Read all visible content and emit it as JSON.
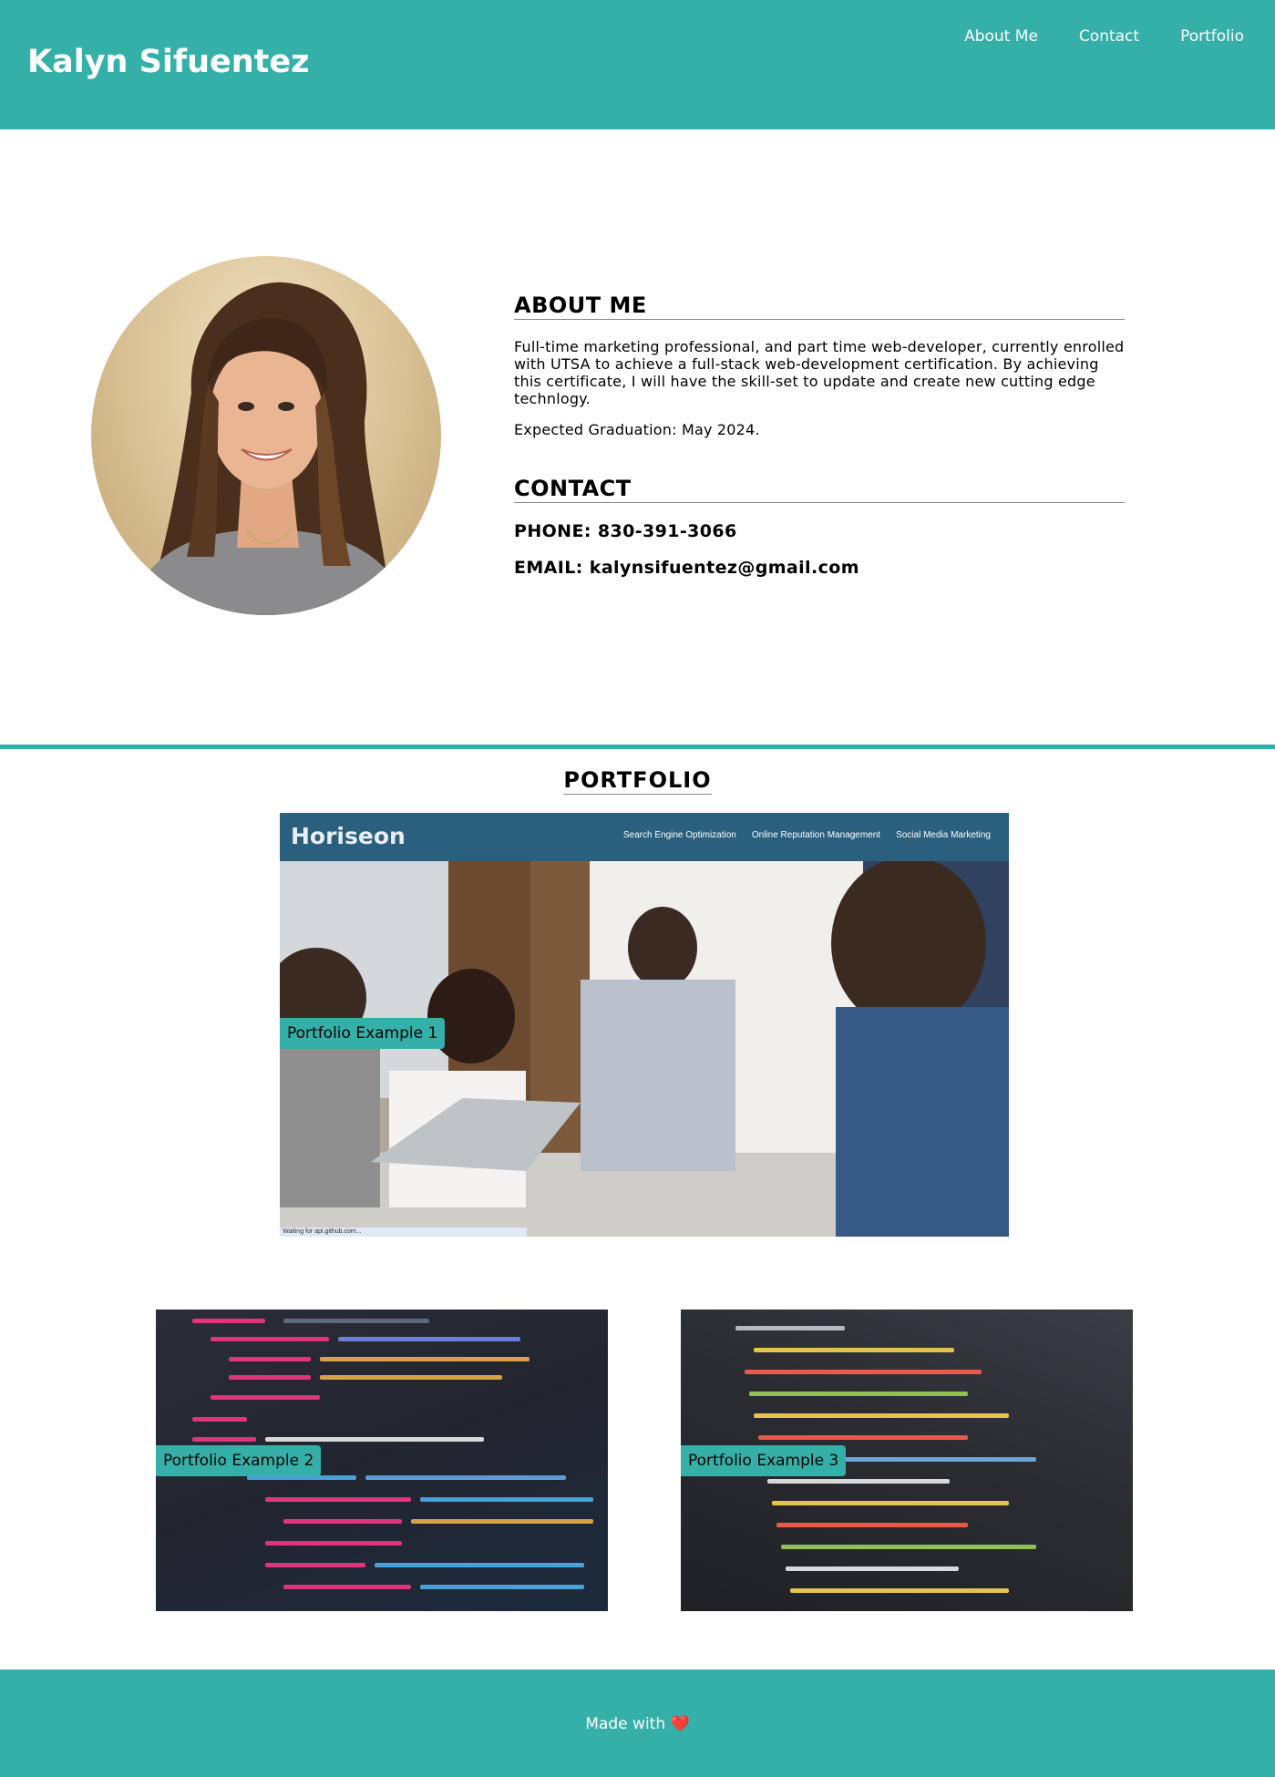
{
  "header": {
    "title": "Kalyn Sifuentez",
    "nav": [
      "About Me",
      "Contact",
      "Portfolio"
    ]
  },
  "about": {
    "heading": "ABOUT ME",
    "text": "Full-time marketing professional, and part time web-developer, currently enrolled with UTSA to achieve a full-stack web-development certification. By achieving this certificate, I will have the skill-set to update and create new cutting edge technlogy.",
    "graduation": "Expected Graduation: May 2024."
  },
  "contact": {
    "heading": "CONTACT",
    "phone": "PHONE: 830-391-3066",
    "email": "EMAIL: kalynsifuentez@gmail.com"
  },
  "portfolio": {
    "heading": "PORTFOLIO",
    "items": [
      {
        "label": "Portfolio Example 1",
        "preview": {
          "logo": "Horiseon",
          "links": [
            "Search Engine Optimization",
            "Online Reputation Management",
            "Social Media Marketing"
          ],
          "status": "Waiting for api.github.com..."
        }
      },
      {
        "label": "Portfolio Example 2"
      },
      {
        "label": "Portfolio Example 3"
      }
    ]
  },
  "footer": {
    "text": "Made with",
    "heart": "❤️"
  },
  "colors": {
    "accent": "#35b0a8",
    "header_text": "#ffffff",
    "heart": "#e8262d"
  },
  "icons": [
    "heart-icon"
  ]
}
